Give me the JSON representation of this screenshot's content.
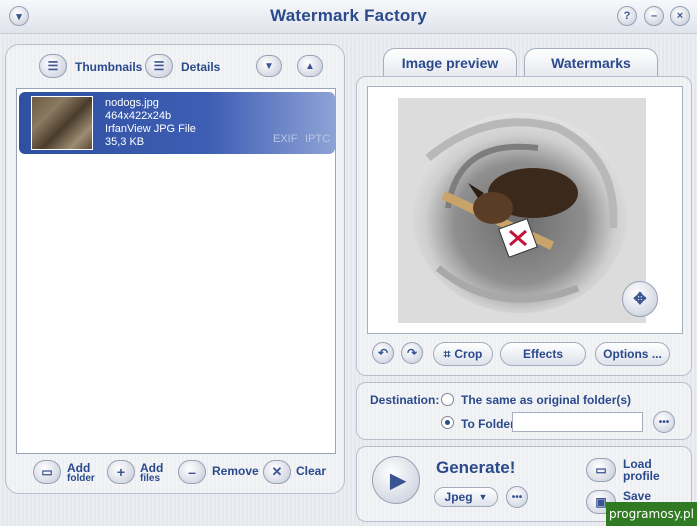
{
  "window": {
    "title": "Watermark Factory"
  },
  "list_panel": {
    "thumbnails_label": "Thumbnails",
    "details_label": "Details",
    "items": [
      {
        "name": "nodogs.jpg",
        "dims": "464x422x24b",
        "type": "IrfanView JPG File",
        "size": "35,3 KB",
        "tag1": "EXIF",
        "tag2": "IPTC"
      }
    ],
    "add_folder_line1": "Add",
    "add_folder_line2": "folder",
    "add_files_line1": "Add",
    "add_files_line2": "files",
    "remove_label": "Remove",
    "clear_label": "Clear"
  },
  "tabs": {
    "preview": "Image preview",
    "watermarks": "Watermarks"
  },
  "preview_tools": {
    "crop": "Crop",
    "effects": "Effects",
    "options": "Options ..."
  },
  "destination": {
    "label": "Destination:",
    "opt_same": "The same as original folder(s)",
    "opt_folder": "To Folder",
    "folder_value": "",
    "selected": "To Folder"
  },
  "generate": {
    "label": "Generate!",
    "format": "Jpeg",
    "load_line1": "Load",
    "load_line2": "profile",
    "save_label": "Save"
  },
  "watermark_badge": "programosy.pl"
}
